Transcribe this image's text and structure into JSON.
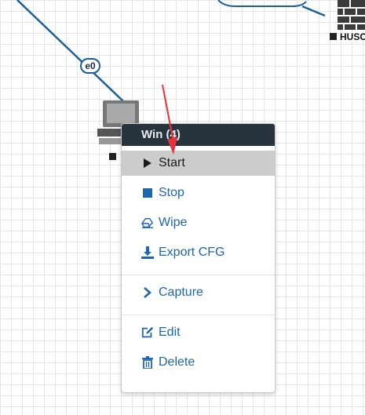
{
  "link": {
    "label": "e0"
  },
  "nodes": {
    "router_name": "HUSC",
    "pc_name_partial": "■"
  },
  "context_menu": {
    "title": "Win (4)",
    "items": [
      {
        "label": "Start",
        "icon": "play-icon",
        "active": true
      },
      {
        "label": "Stop",
        "icon": "stop-icon"
      },
      {
        "label": "Wipe",
        "icon": "eraser-icon"
      },
      {
        "label": "Export CFG",
        "icon": "download-icon"
      }
    ],
    "capture": {
      "label": "Capture",
      "icon": "chevron-right-icon"
    },
    "edit": {
      "label": "Edit",
      "icon": "edit-icon"
    },
    "delete": {
      "label": "Delete",
      "icon": "trash-icon"
    }
  },
  "colors": {
    "link_line": "#1a5f99",
    "menu_header_bg": "#27333d",
    "menu_text": "#1e66ad",
    "active_bg": "#cccccc",
    "annotation_arrow": "#e8323a"
  }
}
